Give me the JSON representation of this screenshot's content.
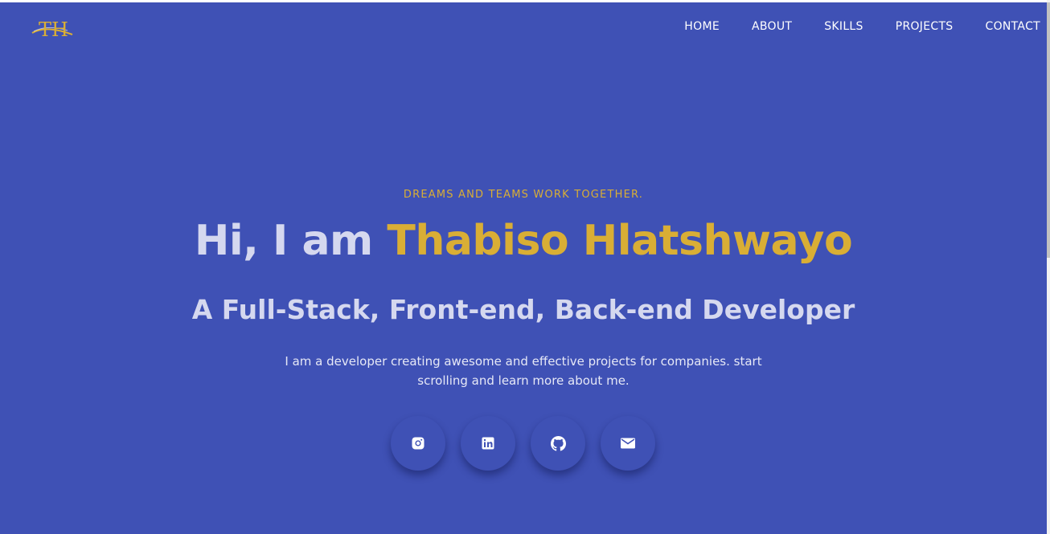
{
  "colors": {
    "background": "#3f51b5",
    "accent": "#d9ae35",
    "text_light": "#d5d8ef",
    "nav_text": "#ffffff"
  },
  "logo": {
    "text": "TH",
    "icon": "logo-icon"
  },
  "nav": {
    "items": [
      {
        "label": "HOME"
      },
      {
        "label": "ABOUT"
      },
      {
        "label": "SKILLS"
      },
      {
        "label": "PROJECTS"
      },
      {
        "label": "CONTACT"
      }
    ]
  },
  "hero": {
    "tagline": "DREAMS AND TEAMS WORK TOGETHER.",
    "greeting": "Hi, I am ",
    "name": "Thabiso Hlatshwayo",
    "role": "A Full-Stack, Front-end, Back-end Developer",
    "intro": "I am a developer creating awesome and effective projects for companies. start scrolling and learn more about me."
  },
  "socials": [
    {
      "icon": "instagram-icon"
    },
    {
      "icon": "linkedin-icon"
    },
    {
      "icon": "github-icon"
    },
    {
      "icon": "email-icon"
    }
  ]
}
